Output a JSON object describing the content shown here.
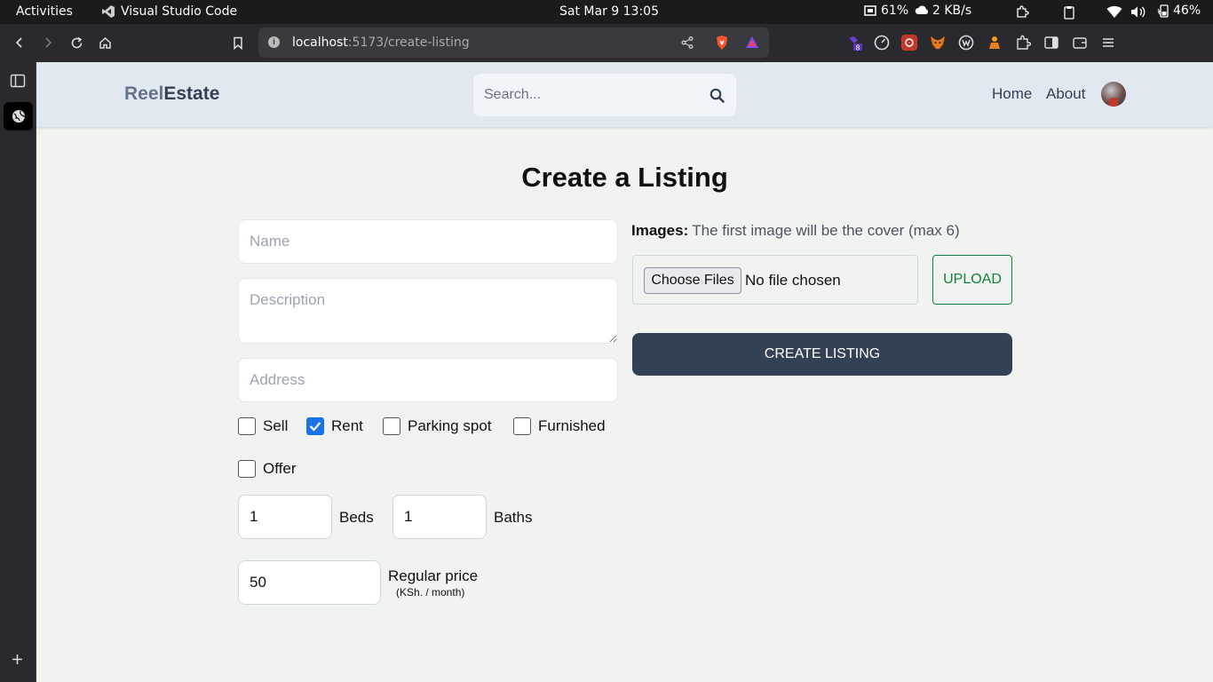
{
  "os": {
    "activities": "Activities",
    "app_name": "Visual Studio Code",
    "clock": "Sat Mar 9  13:05",
    "cpu": "61%",
    "network": "2 KB/s",
    "battery": "46%"
  },
  "browser": {
    "url_host": "localhost",
    "url_path": ":5173/create-listing",
    "extension_badge": "8"
  },
  "header": {
    "logo_part1": "Reel",
    "logo_part2": "Estate",
    "search_placeholder": "Search...",
    "nav_home": "Home",
    "nav_about": "About"
  },
  "form": {
    "title": "Create a Listing",
    "name_placeholder": "Name",
    "description_placeholder": "Description",
    "address_placeholder": "Address",
    "checkboxes": [
      {
        "label": "Sell",
        "checked": false
      },
      {
        "label": "Rent",
        "checked": true
      },
      {
        "label": "Parking spot",
        "checked": false
      },
      {
        "label": "Furnished",
        "checked": false
      },
      {
        "label": "Offer",
        "checked": false
      }
    ],
    "beds_value": "1",
    "beds_label": "Beds",
    "baths_value": "1",
    "baths_label": "Baths",
    "price_value": "50",
    "price_label": "Regular price",
    "price_unit": "(KSh. / month)"
  },
  "images": {
    "label": "Images:",
    "hint": "The first image will be the cover (max 6)",
    "choose_files": "Choose Files",
    "no_file": "No file chosen",
    "upload": "UPLOAD"
  },
  "actions": {
    "create": "CREATE LISTING"
  }
}
